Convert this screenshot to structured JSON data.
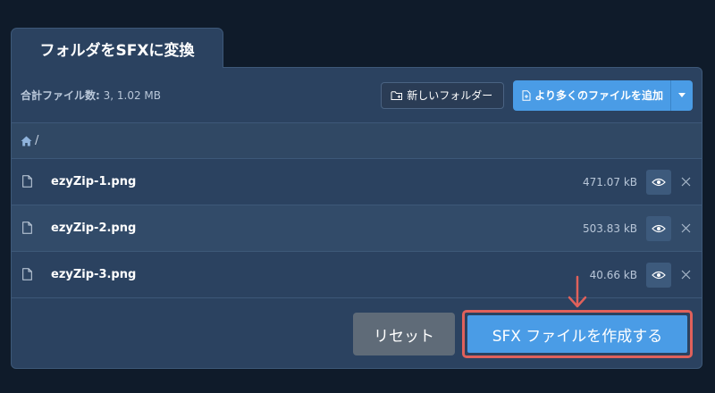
{
  "tab": {
    "title": "フォルダをSFXに変換"
  },
  "toolbar": {
    "count_label": "合計ファイル数:",
    "count_value": " 3, 1.02 MB",
    "new_folder_label": "新しいフォルダー",
    "add_files_label": "より多くのファイルを追加"
  },
  "path": {
    "separator": "/"
  },
  "files": [
    {
      "name": "ezyZip-1.png",
      "size": "471.07 kB"
    },
    {
      "name": "ezyZip-2.png",
      "size": "503.83 kB"
    },
    {
      "name": "ezyZip-3.png",
      "size": "40.66 kB"
    }
  ],
  "actions": {
    "reset_label": "リセット",
    "create_label": "SFX ファイルを作成する"
  },
  "icons": {
    "folder": "folder-add-icon",
    "file_add": "file-add-icon",
    "caret": "chevron-down-icon",
    "home": "home-icon",
    "file": "file-icon",
    "eye": "eye-icon",
    "close": "close-icon",
    "arrow": "arrow-down-icon"
  },
  "colors": {
    "background": "#0f1b2a",
    "panel": "#2b4260",
    "accent": "#4a9ce6",
    "reset": "#5f6b78",
    "highlight": "#e0615b"
  }
}
